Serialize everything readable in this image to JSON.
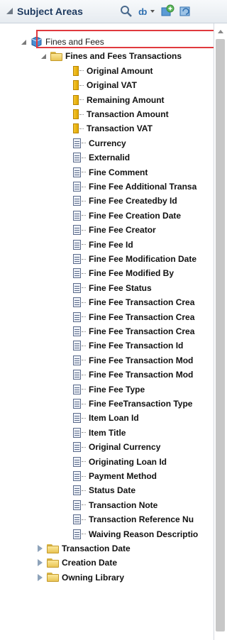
{
  "panel": {
    "title": "Subject Areas"
  },
  "toolbar": {
    "icons": [
      "search-icon",
      "filter-icon",
      "add-icon",
      "refresh-icon"
    ]
  },
  "tree": {
    "root": {
      "label": "Fines and Fees"
    },
    "folder": {
      "label": "Fines and Fees Transactions"
    },
    "measures": [
      "Original Amount",
      "Original VAT",
      "Remaining Amount",
      "Transaction Amount",
      "Transaction VAT"
    ],
    "attributes": [
      "Currency",
      "Externalid",
      "Fine Comment",
      "Fine Fee Additional Transa",
      "Fine Fee Createdby Id",
      "Fine Fee Creation Date",
      "Fine Fee Creator",
      "Fine Fee Id",
      "Fine Fee Modification Date",
      "Fine Fee Modified By",
      "Fine Fee Status",
      "Fine Fee Transaction Crea",
      "Fine Fee Transaction Crea",
      "Fine Fee Transaction Crea",
      "Fine Fee Transaction Id",
      "Fine Fee Transaction Mod",
      "Fine Fee Transaction Mod",
      "Fine Fee Type",
      "Fine FeeTransaction Type",
      "Item Loan Id",
      "Item Title",
      "Original Currency",
      "Originating Loan Id",
      "Payment Method",
      "Status Date",
      "Transaction Note",
      "Transaction Reference Nu",
      "Waiving Reason Descriptio"
    ],
    "collapsed_folders": [
      "Transaction Date",
      "Creation Date",
      "Owning Library"
    ]
  },
  "colors": {
    "highlight": "#e0393e",
    "title": "#1e3a5f"
  }
}
